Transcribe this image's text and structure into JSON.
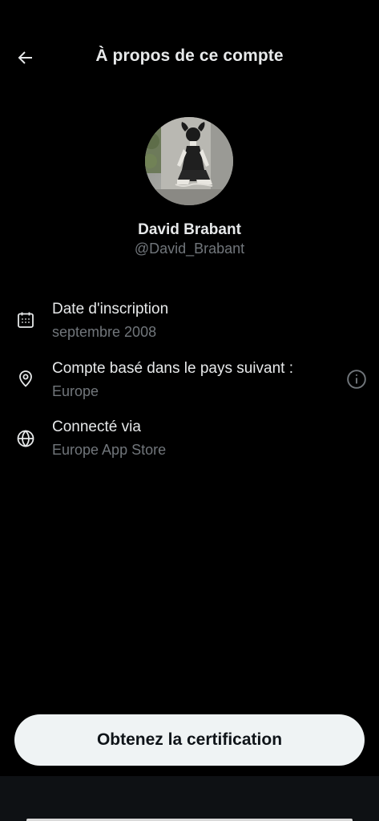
{
  "header": {
    "title": "À propos de ce compte",
    "back_icon": "arrow-left-icon"
  },
  "profile": {
    "display_name": "David Brabant",
    "handle": "@David_Brabant",
    "avatar_icon": "profile-photo"
  },
  "details": [
    {
      "icon": "calendar-icon",
      "label": "Date d'inscription",
      "value": "septembre 2008"
    },
    {
      "icon": "location-pin-icon",
      "label": "Compte basé dans le pays suivant :",
      "value": "Europe",
      "trailing_icon": "info-icon"
    },
    {
      "icon": "globe-icon",
      "label": "Connecté via",
      "value": "Europe App Store"
    }
  ],
  "cta": {
    "label": "Obtenez la certification"
  },
  "colors": {
    "background": "#000000",
    "primary_text": "#e7e9ea",
    "secondary_text": "#71767b",
    "button_bg": "#eff3f4",
    "button_text": "#0f1419"
  }
}
